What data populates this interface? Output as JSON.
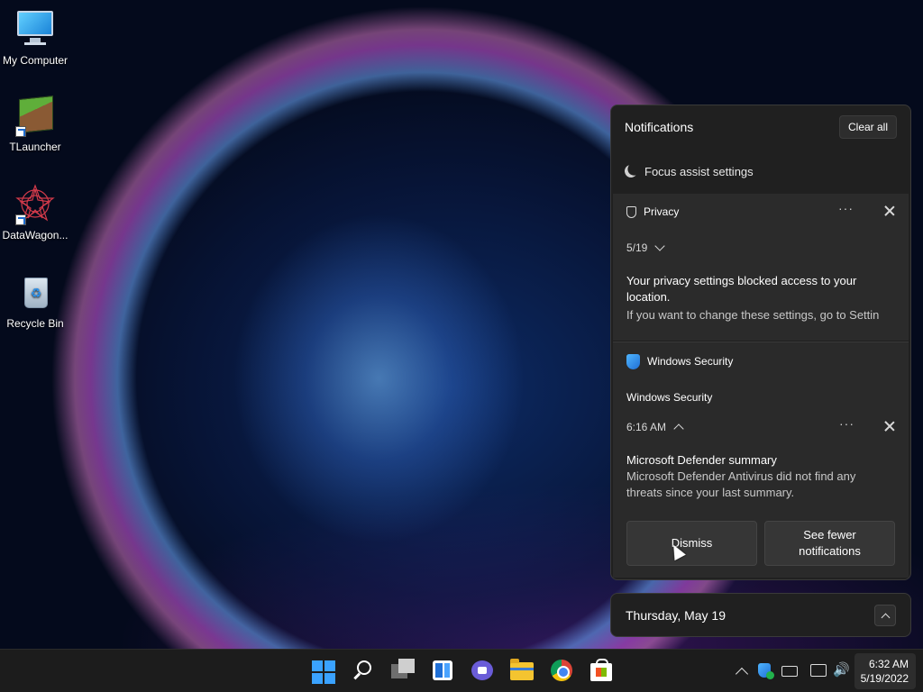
{
  "desktop": {
    "icons": [
      {
        "label": "My Computer",
        "icon": "computer-icon"
      },
      {
        "label": "TLauncher",
        "icon": "minecraft-block-icon"
      },
      {
        "label": "DataWagon...",
        "icon": "datawagon-icon"
      },
      {
        "label": "Recycle Bin",
        "icon": "recycle-bin-icon"
      }
    ]
  },
  "notifications": {
    "title": "Notifications",
    "clear_all": "Clear all",
    "focus_assist": "Focus assist settings",
    "privacy": {
      "app": "Privacy",
      "date": "5/19",
      "title": "Your privacy settings blocked access to your location.",
      "body": "If you want to change these settings, go to Settin"
    },
    "security": {
      "app": "Windows Security",
      "subheader": "Windows Security",
      "time": "6:16 AM",
      "title": "Microsoft Defender summary",
      "body_line1": "Microsoft Defender Antivirus did not find any",
      "body_line2": "threats since your last summary.",
      "dismiss": "Dismiss",
      "see_fewer_line1": "See fewer",
      "see_fewer_line2": "notifications"
    },
    "more_options": "···"
  },
  "calendar": {
    "date": "Thursday, May 19"
  },
  "taskbar": {
    "apps": [
      "start-icon",
      "search-icon",
      "task-view-icon",
      "widgets-icon",
      "chat-icon",
      "file-explorer-icon",
      "chrome-icon",
      "microsoft-store-icon"
    ],
    "tray": [
      "show-hidden-icons",
      "windows-security-icon",
      "keyboard-icon",
      "network-icon",
      "volume-icon"
    ],
    "time": "6:32 AM",
    "date": "5/19/2022",
    "volume_glyph": "🔊"
  },
  "colors": {
    "accent": "#3aa2ff",
    "panel": "#202020",
    "card": "#2b2b2b"
  }
}
